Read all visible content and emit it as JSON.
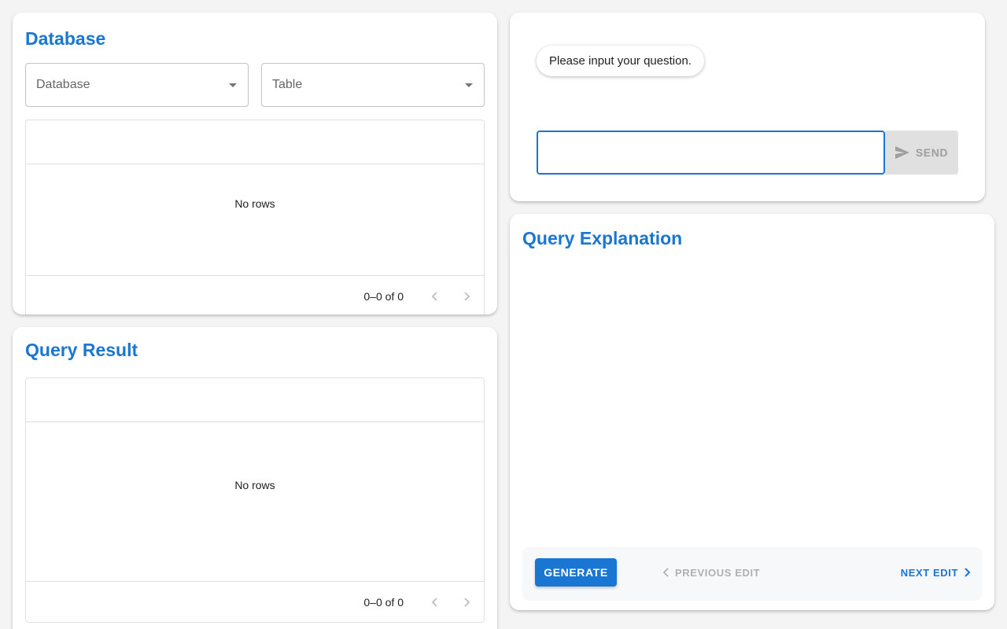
{
  "database_panel": {
    "title": "Database",
    "database_select": {
      "label": "Database"
    },
    "table_select": {
      "label": "Table"
    },
    "grid": {
      "empty_text": "No rows",
      "page_info": "0–0 of 0"
    }
  },
  "query_result_panel": {
    "title": "Query Result",
    "grid": {
      "empty_text": "No rows",
      "page_info": "0–0 of 0"
    }
  },
  "chat_panel": {
    "prompt_bubble": "Please input your question.",
    "input_value": "",
    "send_label": "SEND"
  },
  "explanation_panel": {
    "title": "Query Explanation",
    "generate_label": "GENERATE",
    "previous_label": "PREVIOUS EDIT",
    "next_label": "NEXT EDIT"
  },
  "colors": {
    "accent": "#1976d2",
    "disabled_text": "#9e9e9e",
    "disabled_bg": "#e0e0e0"
  }
}
